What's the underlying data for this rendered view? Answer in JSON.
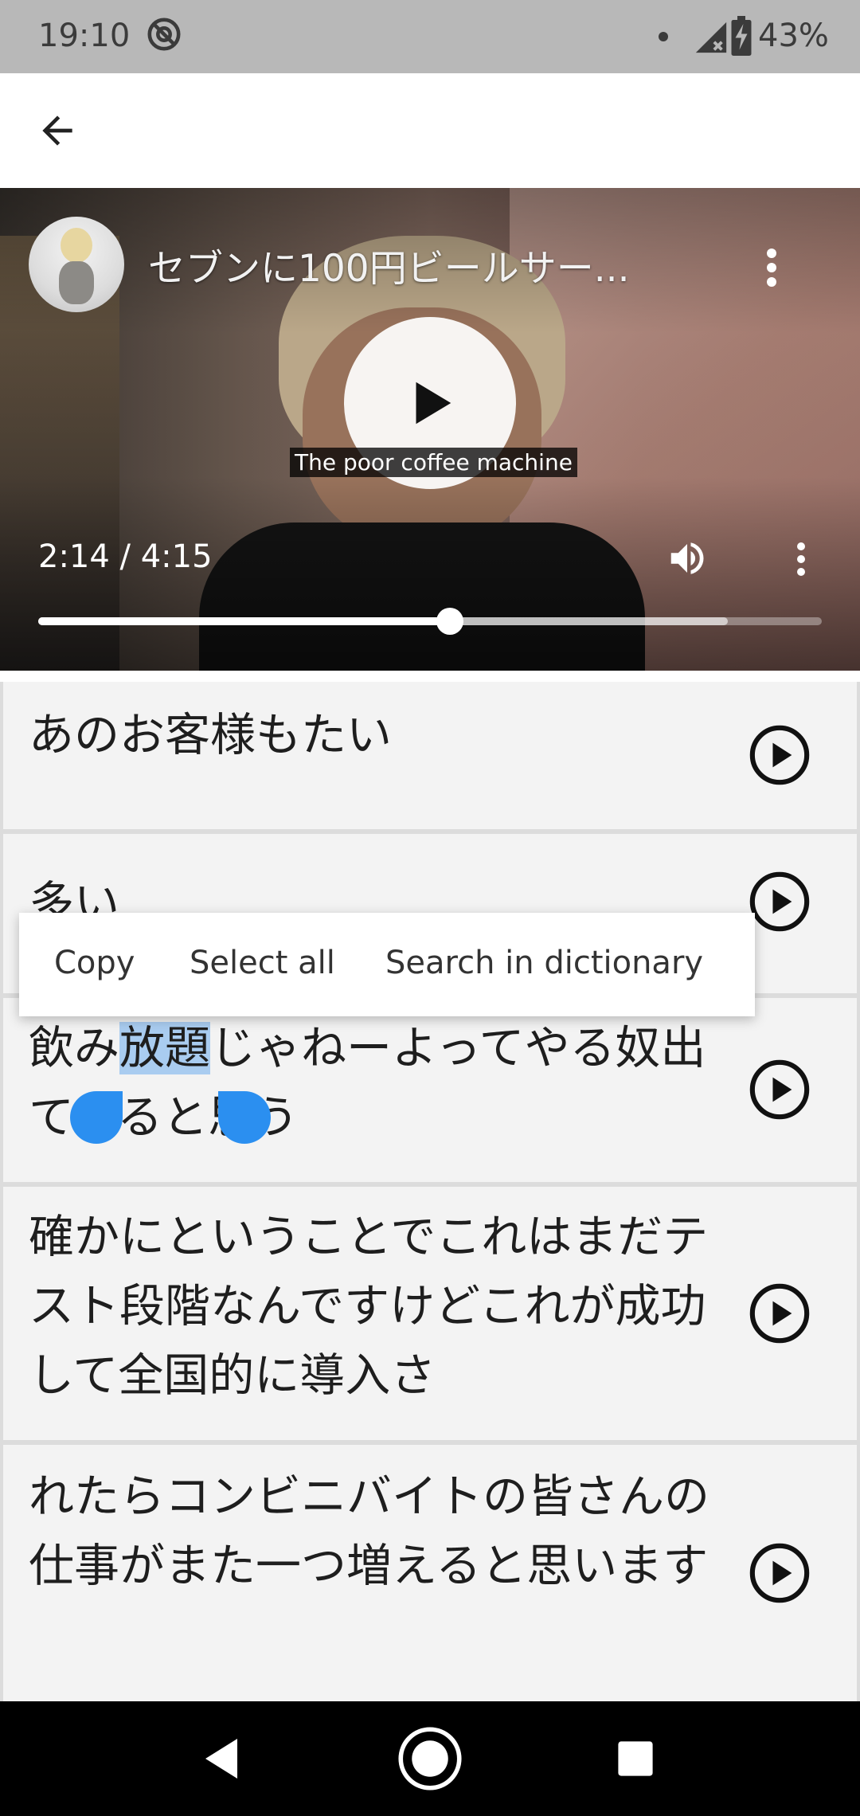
{
  "status_bar": {
    "time": "19:10",
    "battery": "43%",
    "icons": [
      "at-sign-icon",
      "notification-dot-icon",
      "signal-icon",
      "battery-charging-icon"
    ]
  },
  "app_bar": {
    "back_icon": "arrow-left-icon"
  },
  "video": {
    "title": "セブンに100円ビールサー...",
    "caption": "The poor coffee machine",
    "time": "2:14 / 4:15",
    "progress": 0.525,
    "buffered": 0.88,
    "icons": [
      "play-icon",
      "volume-icon",
      "more-vert-icon"
    ]
  },
  "subtitles": [
    {
      "text": "あのお客様もたい"
    },
    {
      "text": "多い"
    },
    {
      "pre": "飲み",
      "selected": "放題",
      "post": "じゃねーよってやる奴出てくると思う"
    },
    {
      "text": "確かにということでこれはまだテスト段階なんですけどこれが成功して全国的に導入さ"
    },
    {
      "text": "れたらコンビニバイトの皆さんの仕事がまた一つ増えると思います"
    }
  ],
  "context_menu": {
    "copy": "Copy",
    "select_all": "Select all",
    "search": "Search in dictionary"
  },
  "colors": {
    "status_bar": "#b8b8b8",
    "selection": "#a9ccf0",
    "handle": "#2b8ff0",
    "list_item_bg": "#f3f3f3"
  }
}
